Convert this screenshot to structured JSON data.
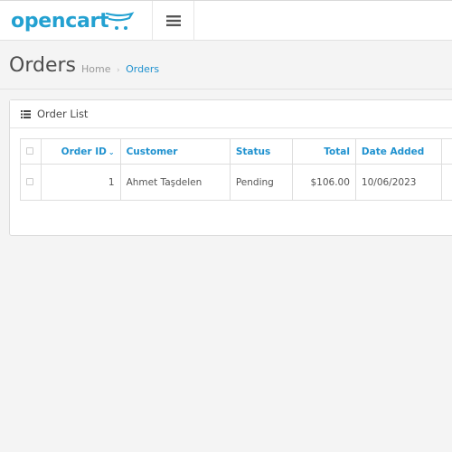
{
  "header": {
    "logo_text": "opencart",
    "brand_color": "#23a1d1",
    "menu_icon": "hamburger-icon"
  },
  "page": {
    "title": "Orders",
    "breadcrumb": [
      {
        "label": "Home"
      },
      {
        "label": "Orders"
      }
    ],
    "breadcrumb_separator": "›"
  },
  "panel": {
    "title": "Order List",
    "icon": "list-icon"
  },
  "table": {
    "columns": {
      "order_id": "Order ID",
      "sort_indicator": "⌄",
      "customer": "Customer",
      "status": "Status",
      "total": "Total",
      "date_added": "Date Added"
    },
    "rows": [
      {
        "order_id": "1",
        "customer": "Ahmet Taşdelen",
        "status": "Pending",
        "total": "$106.00",
        "date_added": "10/06/2023"
      }
    ]
  },
  "colors": {
    "link": "#1e91cf",
    "background": "#f4f4f4"
  }
}
